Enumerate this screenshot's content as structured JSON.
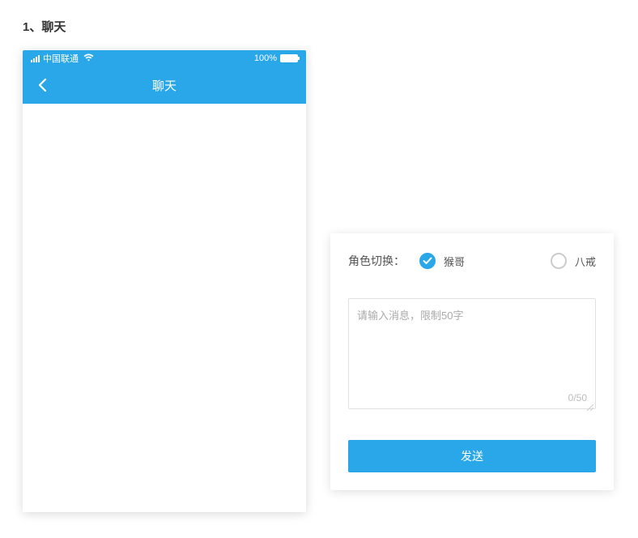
{
  "section_title": "1、聊天",
  "phone": {
    "status_bar": {
      "carrier": "中国联通",
      "battery_text": "100%"
    },
    "nav": {
      "title": "聊天"
    }
  },
  "panel": {
    "role_label": "角色切换：",
    "roles": [
      {
        "label": "猴哥",
        "selected": true
      },
      {
        "label": "八戒",
        "selected": false
      }
    ],
    "textarea": {
      "placeholder": "请输入消息，限制50字",
      "value": "",
      "count": "0/50",
      "max": 50
    },
    "send_label": "发送"
  },
  "colors": {
    "primary": "#29a7e8"
  }
}
